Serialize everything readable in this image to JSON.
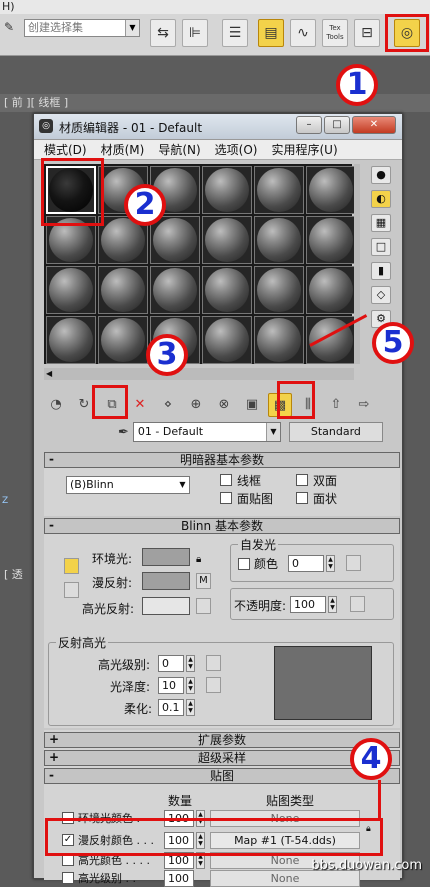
{
  "top_strip": {
    "text": "H)"
  },
  "max_toolbar": {
    "selection_set_placeholder": "创建选择集",
    "small_btn_label": "Tex Tools"
  },
  "viewport": {
    "front_label": "[ 前 ][ 线框 ]",
    "persp_label": "[ 透",
    "axis_label": "Z"
  },
  "material_editor": {
    "title": "材质编辑器 - 01 - Default",
    "menus": [
      "模式(D)",
      "材质(M)",
      "导航(N)",
      "选项(O)",
      "实用程序(U)"
    ],
    "material_name": "01 - Default",
    "material_type": "Standard",
    "shader_basic": {
      "header": "明暗器基本参数",
      "shader": "(B)Blinn",
      "wire_label": "线框",
      "two_sided_label": "双面",
      "face_map_label": "面贴图",
      "faceted_label": "面状"
    },
    "blinn_basic": {
      "header": "Blinn 基本参数",
      "self_illum_title": "自发光",
      "color_label": "颜色",
      "self_illum_value": "0",
      "ambient_label": "环境光:",
      "diffuse_label": "漫反射:",
      "specular_label": "高光反射:",
      "m_label": "M",
      "opacity_label": "不透明度:",
      "opacity_value": "100",
      "spec_highlights_title": "反射高光",
      "spec_level_label": "高光级别:",
      "spec_level_value": "0",
      "glossiness_label": "光泽度:",
      "glossiness_value": "10",
      "soften_label": "柔化:",
      "soften_value": "0.1"
    },
    "collapsed_rollouts": [
      "扩展参数",
      "超级采样"
    ],
    "maps": {
      "header": "贴图",
      "col_amount": "数量",
      "col_map_type": "贴图类型",
      "rows": [
        {
          "label": "环境光颜色 .",
          "checked": false,
          "amount": "100",
          "map": "None"
        },
        {
          "label": "漫反射颜色 . . .",
          "checked": true,
          "amount": "100",
          "map": "Map #1 (T-54.dds)"
        },
        {
          "label": "高光颜色 . . . .",
          "checked": false,
          "amount": "100",
          "map": "None"
        },
        {
          "label": "高光级别 . .",
          "checked": false,
          "amount": "100",
          "map": "None"
        }
      ]
    }
  },
  "callouts": [
    "1",
    "2",
    "3",
    "4",
    "5"
  ],
  "watermark": "bbs.duowan.com",
  "colors": {
    "accent_yellow": "#f3d24a",
    "callout_red": "#e01010",
    "callout_blue": "#1a2fd0"
  }
}
